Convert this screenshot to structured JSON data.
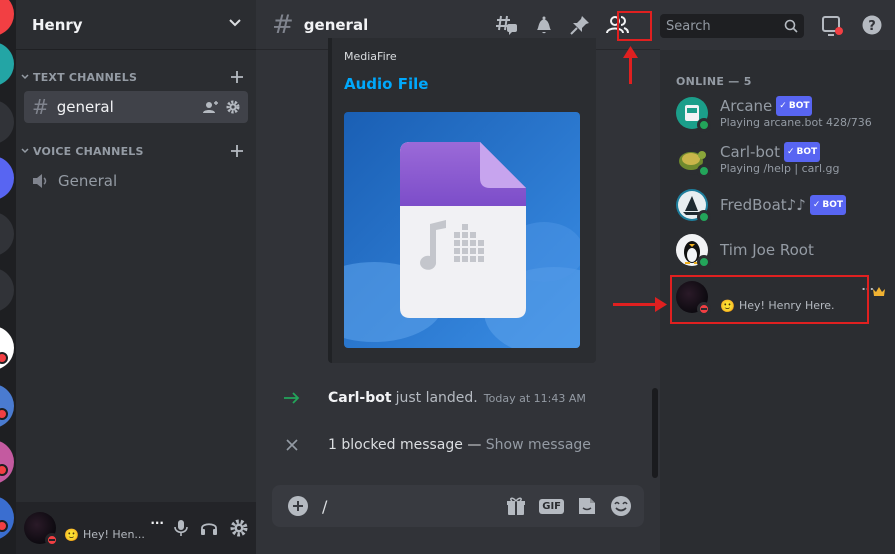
{
  "guild": {
    "name": "Henry"
  },
  "sidebar": {
    "categories": [
      {
        "label": "TEXT CHANNELS"
      },
      {
        "label": "VOICE CHANNELS"
      }
    ],
    "channels": [
      {
        "name": "general"
      },
      {
        "name": "General"
      }
    ]
  },
  "user_panel": {
    "name": "...",
    "status": "Hey! Hen..."
  },
  "chat": {
    "channel": "general",
    "embed": {
      "provider": "MediaFire",
      "title": "Audio File"
    },
    "join": {
      "user": "Carl-bot",
      "text": "just landed.",
      "time": "Today at 11:43 AM"
    },
    "blocked": {
      "text": "1 blocked message — ",
      "link": "Show message"
    },
    "composer": {
      "value": "/"
    }
  },
  "search": {
    "placeholder": "Search"
  },
  "members": {
    "header": "ONLINE — 5",
    "bot_tag": "BOT",
    "list": [
      {
        "name": "Arcane",
        "activity": "Playing arcane.bot 428/736",
        "bot": true
      },
      {
        "name": "Carl-bot",
        "activity": "Playing /help | carl.gg",
        "bot": true
      },
      {
        "name": "FredBoat♪♪",
        "activity": "",
        "bot": true
      },
      {
        "name": "Tim Joe Root",
        "activity": "",
        "bot": false
      },
      {
        "name": "",
        "status": "Hey! Henry Here.",
        "more": "..."
      }
    ]
  },
  "colors": {
    "accent": "#5865f2",
    "link": "#00a8fc",
    "online": "#23a55a",
    "dnd": "#f23f43",
    "highlight": "#e02020"
  }
}
